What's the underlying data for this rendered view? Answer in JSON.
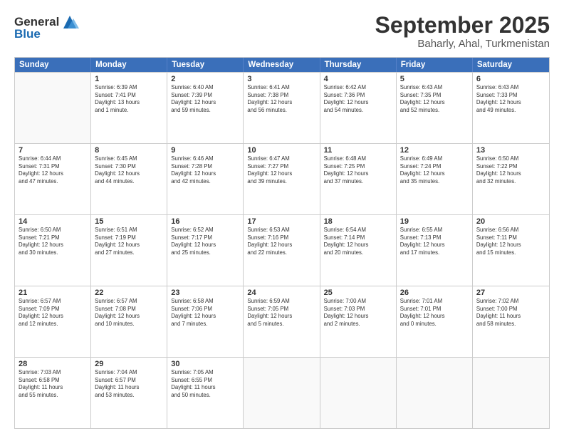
{
  "header": {
    "logo_general": "General",
    "logo_blue": "Blue",
    "month_title": "September 2025",
    "location": "Baharly, Ahal, Turkmenistan"
  },
  "days_of_week": [
    "Sunday",
    "Monday",
    "Tuesday",
    "Wednesday",
    "Thursday",
    "Friday",
    "Saturday"
  ],
  "weeks": [
    [
      {
        "day": "",
        "info": ""
      },
      {
        "day": "1",
        "info": "Sunrise: 6:39 AM\nSunset: 7:41 PM\nDaylight: 13 hours\nand 1 minute."
      },
      {
        "day": "2",
        "info": "Sunrise: 6:40 AM\nSunset: 7:39 PM\nDaylight: 12 hours\nand 59 minutes."
      },
      {
        "day": "3",
        "info": "Sunrise: 6:41 AM\nSunset: 7:38 PM\nDaylight: 12 hours\nand 56 minutes."
      },
      {
        "day": "4",
        "info": "Sunrise: 6:42 AM\nSunset: 7:36 PM\nDaylight: 12 hours\nand 54 minutes."
      },
      {
        "day": "5",
        "info": "Sunrise: 6:43 AM\nSunset: 7:35 PM\nDaylight: 12 hours\nand 52 minutes."
      },
      {
        "day": "6",
        "info": "Sunrise: 6:43 AM\nSunset: 7:33 PM\nDaylight: 12 hours\nand 49 minutes."
      }
    ],
    [
      {
        "day": "7",
        "info": "Sunrise: 6:44 AM\nSunset: 7:31 PM\nDaylight: 12 hours\nand 47 minutes."
      },
      {
        "day": "8",
        "info": "Sunrise: 6:45 AM\nSunset: 7:30 PM\nDaylight: 12 hours\nand 44 minutes."
      },
      {
        "day": "9",
        "info": "Sunrise: 6:46 AM\nSunset: 7:28 PM\nDaylight: 12 hours\nand 42 minutes."
      },
      {
        "day": "10",
        "info": "Sunrise: 6:47 AM\nSunset: 7:27 PM\nDaylight: 12 hours\nand 39 minutes."
      },
      {
        "day": "11",
        "info": "Sunrise: 6:48 AM\nSunset: 7:25 PM\nDaylight: 12 hours\nand 37 minutes."
      },
      {
        "day": "12",
        "info": "Sunrise: 6:49 AM\nSunset: 7:24 PM\nDaylight: 12 hours\nand 35 minutes."
      },
      {
        "day": "13",
        "info": "Sunrise: 6:50 AM\nSunset: 7:22 PM\nDaylight: 12 hours\nand 32 minutes."
      }
    ],
    [
      {
        "day": "14",
        "info": "Sunrise: 6:50 AM\nSunset: 7:21 PM\nDaylight: 12 hours\nand 30 minutes."
      },
      {
        "day": "15",
        "info": "Sunrise: 6:51 AM\nSunset: 7:19 PM\nDaylight: 12 hours\nand 27 minutes."
      },
      {
        "day": "16",
        "info": "Sunrise: 6:52 AM\nSunset: 7:17 PM\nDaylight: 12 hours\nand 25 minutes."
      },
      {
        "day": "17",
        "info": "Sunrise: 6:53 AM\nSunset: 7:16 PM\nDaylight: 12 hours\nand 22 minutes."
      },
      {
        "day": "18",
        "info": "Sunrise: 6:54 AM\nSunset: 7:14 PM\nDaylight: 12 hours\nand 20 minutes."
      },
      {
        "day": "19",
        "info": "Sunrise: 6:55 AM\nSunset: 7:13 PM\nDaylight: 12 hours\nand 17 minutes."
      },
      {
        "day": "20",
        "info": "Sunrise: 6:56 AM\nSunset: 7:11 PM\nDaylight: 12 hours\nand 15 minutes."
      }
    ],
    [
      {
        "day": "21",
        "info": "Sunrise: 6:57 AM\nSunset: 7:09 PM\nDaylight: 12 hours\nand 12 minutes."
      },
      {
        "day": "22",
        "info": "Sunrise: 6:57 AM\nSunset: 7:08 PM\nDaylight: 12 hours\nand 10 minutes."
      },
      {
        "day": "23",
        "info": "Sunrise: 6:58 AM\nSunset: 7:06 PM\nDaylight: 12 hours\nand 7 minutes."
      },
      {
        "day": "24",
        "info": "Sunrise: 6:59 AM\nSunset: 7:05 PM\nDaylight: 12 hours\nand 5 minutes."
      },
      {
        "day": "25",
        "info": "Sunrise: 7:00 AM\nSunset: 7:03 PM\nDaylight: 12 hours\nand 2 minutes."
      },
      {
        "day": "26",
        "info": "Sunrise: 7:01 AM\nSunset: 7:01 PM\nDaylight: 12 hours\nand 0 minutes."
      },
      {
        "day": "27",
        "info": "Sunrise: 7:02 AM\nSunset: 7:00 PM\nDaylight: 11 hours\nand 58 minutes."
      }
    ],
    [
      {
        "day": "28",
        "info": "Sunrise: 7:03 AM\nSunset: 6:58 PM\nDaylight: 11 hours\nand 55 minutes."
      },
      {
        "day": "29",
        "info": "Sunrise: 7:04 AM\nSunset: 6:57 PM\nDaylight: 11 hours\nand 53 minutes."
      },
      {
        "day": "30",
        "info": "Sunrise: 7:05 AM\nSunset: 6:55 PM\nDaylight: 11 hours\nand 50 minutes."
      },
      {
        "day": "",
        "info": ""
      },
      {
        "day": "",
        "info": ""
      },
      {
        "day": "",
        "info": ""
      },
      {
        "day": "",
        "info": ""
      }
    ]
  ]
}
